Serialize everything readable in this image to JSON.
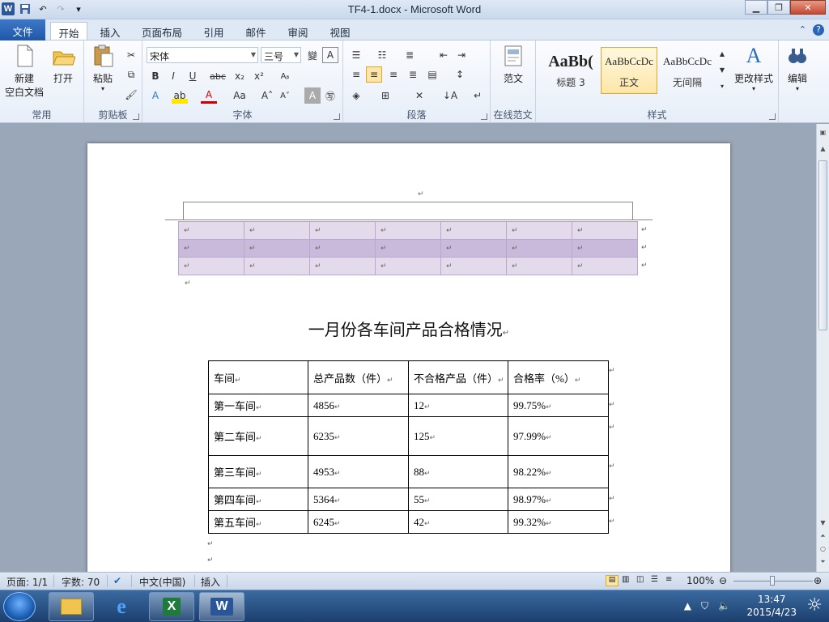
{
  "window": {
    "title": "TF4-1.docx - Microsoft Word"
  },
  "tabs": [
    "文件",
    "开始",
    "插入",
    "页面布局",
    "引用",
    "邮件",
    "审阅",
    "视图"
  ],
  "ribbon": {
    "groups": {
      "common": {
        "label": "常用",
        "new_label": "新建",
        "new_label2": "空白文档",
        "open_label": "打开"
      },
      "clipboard": {
        "label": "剪贴板",
        "paste_label": "粘贴"
      },
      "font": {
        "label": "字体",
        "font_name": "宋体",
        "font_size": "三号"
      },
      "paragraph": {
        "label": "段落"
      },
      "online": {
        "label": "在线范文",
        "fanwen_label": "范文"
      },
      "styles": {
        "label": "样式",
        "items": [
          {
            "preview": "AaBb(",
            "name": "标题 3"
          },
          {
            "preview": "AaBbCcDc",
            "name": "正文"
          },
          {
            "preview": "AaBbCcDc",
            "name": "无间隔"
          }
        ],
        "change_label": "更改样式"
      },
      "editing": {
        "label": "编辑"
      }
    }
  },
  "document": {
    "title": "一月份各车间产品合格情况",
    "table": {
      "headers": [
        "车间",
        "总产品数（件）",
        "不合格产品（件）",
        "合格率（%）"
      ],
      "rows": [
        [
          "第一车间",
          "4856",
          "12",
          "99.75%"
        ],
        [
          "第二车间",
          "6235",
          "125",
          "97.99%"
        ],
        [
          "第三车间",
          "4953",
          "88",
          "98.22%"
        ],
        [
          "第四车间",
          "5364",
          "55",
          "98.97%"
        ],
        [
          "第五车间",
          "6245",
          "42",
          "99.32%"
        ]
      ]
    }
  },
  "statusbar": {
    "page": "页面: 1/1",
    "words": "字数: 70",
    "lang": "中文(中国)",
    "mode": "插入",
    "zoom": "100%"
  },
  "taskbar": {
    "time": "13:47",
    "date": "2015/4/23"
  }
}
